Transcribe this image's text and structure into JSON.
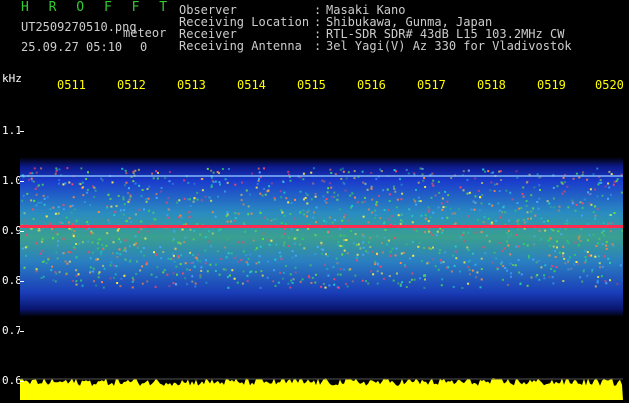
{
  "header": {
    "title": "H R O F F T",
    "filename": "UT2509270510.png",
    "meteor": "meteor",
    "date_time": "25.09.27 05:10",
    "count": "0"
  },
  "info": [
    {
      "label": "Observer",
      "value": "Masaki Kano"
    },
    {
      "label": "Receiving Location",
      "value": "Shibukawa, Gunma, Japan"
    },
    {
      "label": "Receiver",
      "value": "RTL-SDR SDR# 43dB L15 103.2MHz CW"
    },
    {
      "label": "Receiving Antenna",
      "value": "3el Yagi(V) Az 330 for Vladivostok"
    }
  ],
  "axis": {
    "unit": "kHz",
    "y_ticks": [
      "1.1",
      "1.0",
      "0.9",
      "0.8",
      "0.7",
      "0.6"
    ],
    "x_ticks": [
      "0511",
      "0512",
      "0513",
      "0514",
      "0515",
      "0516",
      "0517",
      "0518",
      "0519",
      "0520"
    ]
  },
  "colors": {
    "title": "#33cc33",
    "time_labels": "#ffff00",
    "signal_band": "#1d3fd0",
    "carrier_line": "#ff2a50",
    "noise_floor": "#ffff00"
  }
}
